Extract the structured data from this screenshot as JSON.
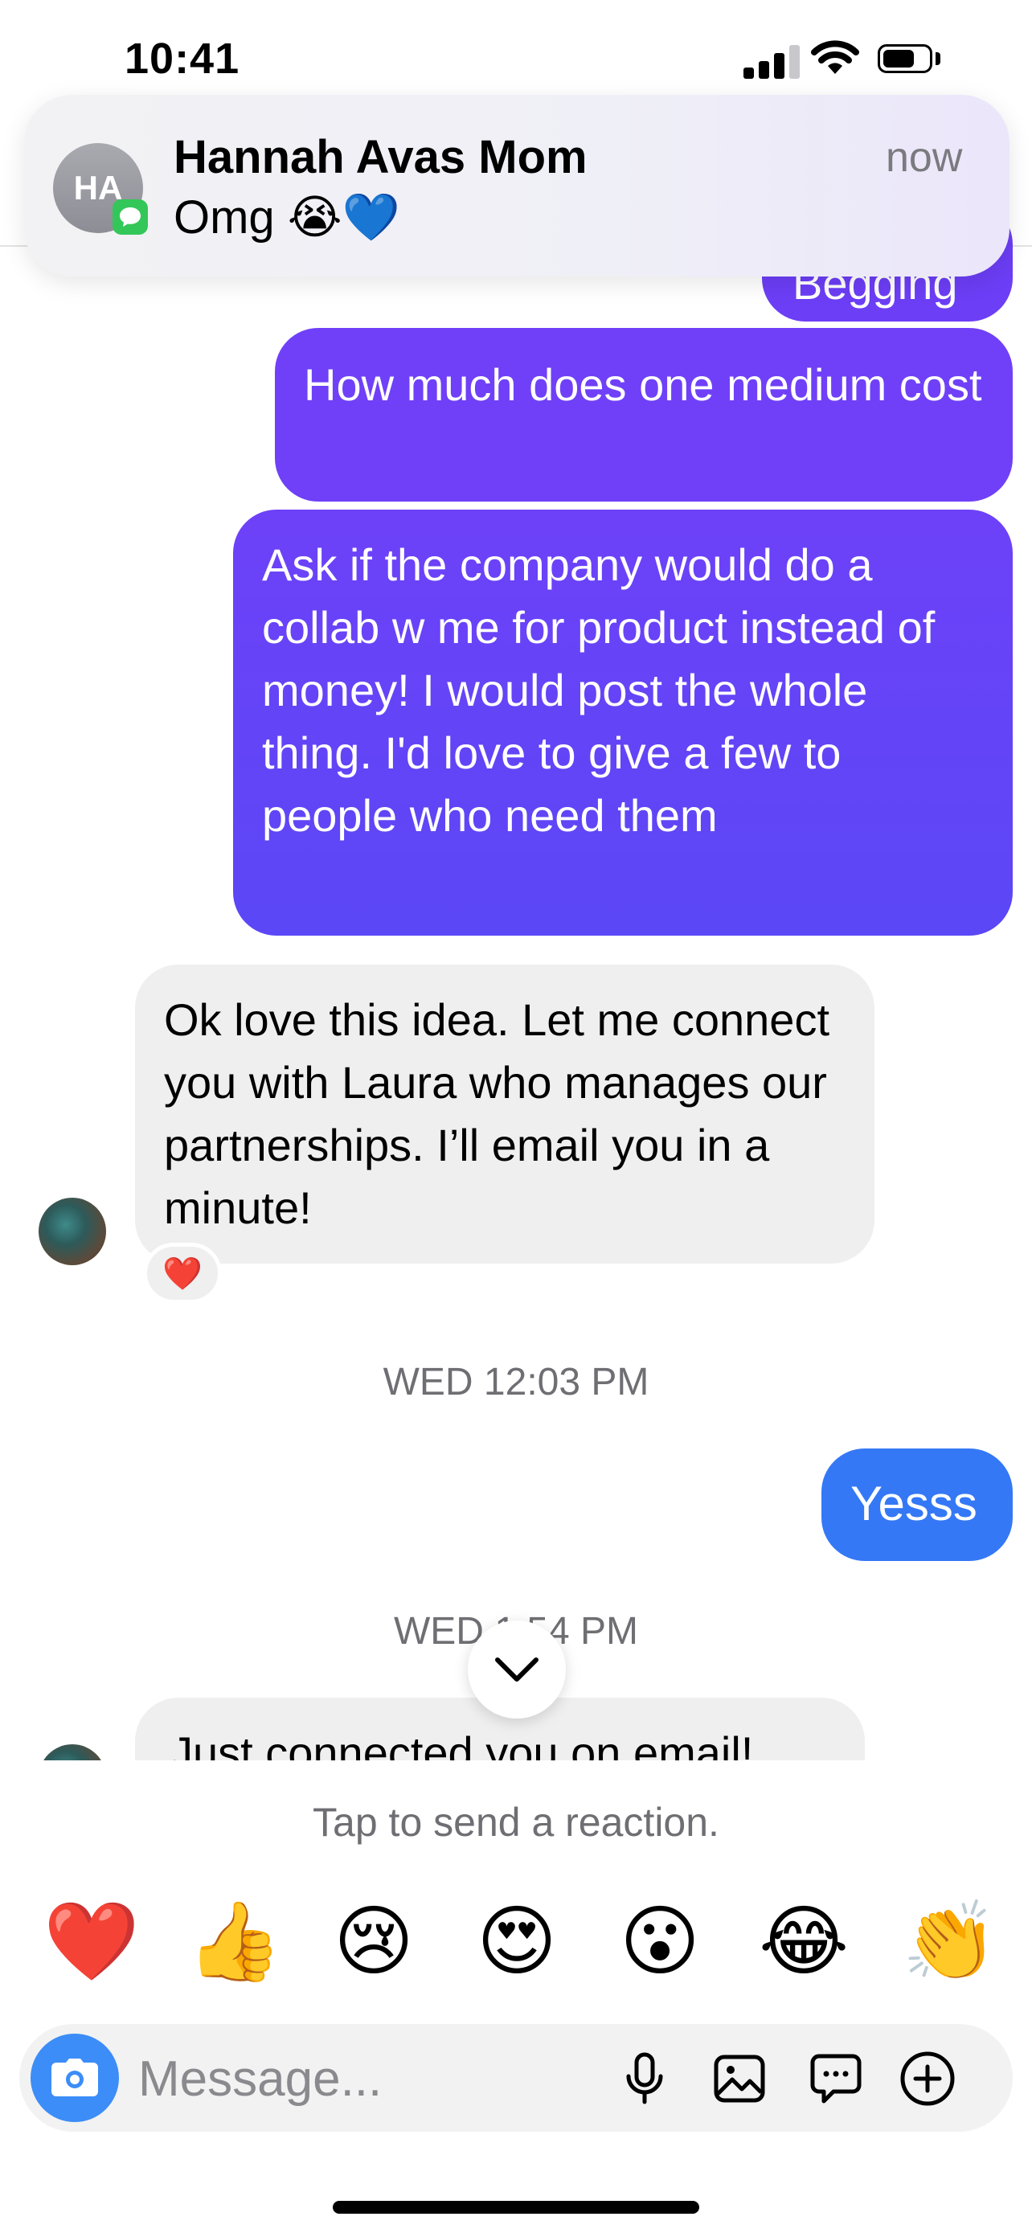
{
  "status_bar": {
    "time": "10:41"
  },
  "notification": {
    "avatar_initials": "HA",
    "title": "Hannah Avas Mom",
    "body": "Omg 😭💙",
    "time": "now"
  },
  "thread": {
    "messages": [
      {
        "direction": "sent",
        "text": "Begging"
      },
      {
        "direction": "sent",
        "text": "How much does one medium cost"
      },
      {
        "direction": "sent",
        "text": "Ask if the company would do a collab w me for product instead of money! I would post the whole thing. I'd love to give a few to people who need them"
      },
      {
        "direction": "received",
        "text": "Ok love this idea. Let me connect you with Laura who manages our partnerships. I’ll email you in a minute!",
        "reaction": "❤️"
      },
      {
        "direction": "sent",
        "text": "Yesss"
      },
      {
        "direction": "received",
        "text": "Just connected you on email!"
      }
    ],
    "timestamps": [
      "WED 12:03 PM",
      "WED 1:54 PM"
    ]
  },
  "reactions": {
    "hint": "Tap to send a reaction.",
    "emojis": [
      "❤️",
      "👍",
      "😢",
      "😍",
      "😮",
      "😂",
      "👏"
    ]
  },
  "composer": {
    "placeholder": "Message..."
  }
}
